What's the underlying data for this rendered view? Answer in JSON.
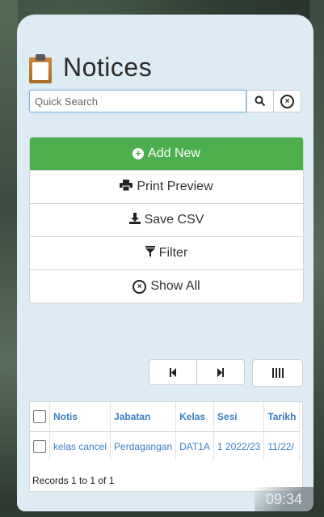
{
  "app": {
    "title": "Notices",
    "title_icon": "clipboard-icon"
  },
  "search": {
    "placeholder": "Quick Search",
    "value": "",
    "search_icon": "search-icon",
    "clear_icon": "clear-icon"
  },
  "actions": {
    "add_new": "Add New",
    "print_preview": "Print Preview",
    "save_csv": "Save CSV",
    "filter": "Filter",
    "show_all": "Show All"
  },
  "pagination": {
    "first_icon": "first-page-icon",
    "last_icon": "last-page-icon",
    "columns_icon": "columns-icon"
  },
  "table": {
    "columns": [
      "Notis",
      "Jabatan",
      "Kelas",
      "Sesi",
      "Tarikh"
    ],
    "rows": [
      {
        "notis": "kelas cancel",
        "jabatan": "Perdagangan",
        "kelas": "DAT1A",
        "sesi": "1 2022/23",
        "tarikh": "11/22/"
      }
    ],
    "records_text": "Records 1 to 1 of 1"
  },
  "status": {
    "time": "09:34"
  },
  "colors": {
    "accent_green": "#4cae4c",
    "link_blue": "#3a7fc1",
    "panel_bg": "#dcebf4"
  }
}
